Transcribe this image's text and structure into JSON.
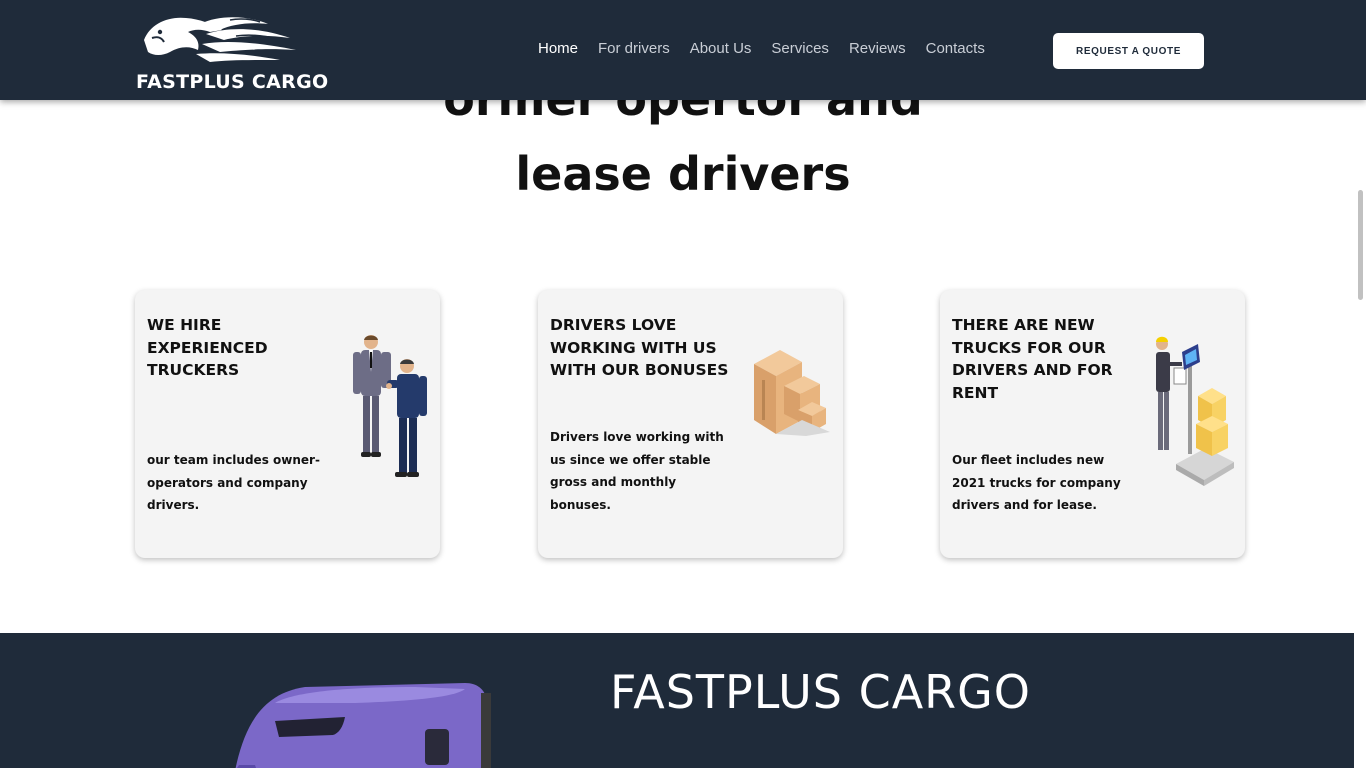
{
  "header": {
    "logo_text": "FASTPLUS CARGO",
    "nav": [
      {
        "label": "Home",
        "active": true
      },
      {
        "label": "For drivers"
      },
      {
        "label": "About Us"
      },
      {
        "label": "Services"
      },
      {
        "label": "Reviews"
      },
      {
        "label": "Contacts"
      }
    ],
    "cta_label": "REQUEST A QUOTE"
  },
  "hero": {
    "line1": "ormer opertor and",
    "line2": "lease drivers"
  },
  "cards": [
    {
      "title": "WE HIRE EXPERIENCED TRUCKERS",
      "text": "our team includes owner-operators and company drivers.",
      "icon": "handshake-illustration"
    },
    {
      "title": "DRIVERS LOVE WORKING WITH US WITH OUR BONUSES",
      "text": "Drivers love working with us since we offer stable gross and monthly bonuses.",
      "icon": "boxes-illustration"
    },
    {
      "title": "THERE ARE NEW TRUCKS FOR OUR DRIVERS AND FOR RENT",
      "text": "Our fleet includes new 2021 trucks for company drivers and for lease.",
      "icon": "warehouse-worker-illustration"
    }
  ],
  "bottom": {
    "title": "FASTPLUS CARGO",
    "icon": "truck-illustration"
  },
  "colors": {
    "header_bg": "#1f2b3a",
    "card_bg": "#f4f4f4",
    "truck": "#7b68c8"
  }
}
